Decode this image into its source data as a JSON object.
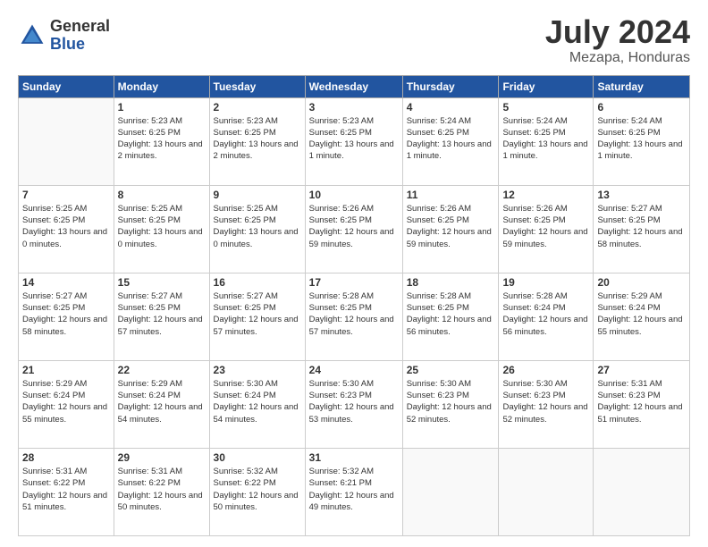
{
  "logo": {
    "general": "General",
    "blue": "Blue"
  },
  "title": "July 2024",
  "subtitle": "Mezapa, Honduras",
  "weekdays": [
    "Sunday",
    "Monday",
    "Tuesday",
    "Wednesday",
    "Thursday",
    "Friday",
    "Saturday"
  ],
  "weeks": [
    [
      null,
      {
        "day": 1,
        "sunrise": "5:23 AM",
        "sunset": "6:25 PM",
        "daylight": "13 hours and 2 minutes."
      },
      {
        "day": 2,
        "sunrise": "5:23 AM",
        "sunset": "6:25 PM",
        "daylight": "13 hours and 2 minutes."
      },
      {
        "day": 3,
        "sunrise": "5:23 AM",
        "sunset": "6:25 PM",
        "daylight": "13 hours and 1 minute."
      },
      {
        "day": 4,
        "sunrise": "5:24 AM",
        "sunset": "6:25 PM",
        "daylight": "13 hours and 1 minute."
      },
      {
        "day": 5,
        "sunrise": "5:24 AM",
        "sunset": "6:25 PM",
        "daylight": "13 hours and 1 minute."
      },
      {
        "day": 6,
        "sunrise": "5:24 AM",
        "sunset": "6:25 PM",
        "daylight": "13 hours and 1 minute."
      }
    ],
    [
      {
        "day": 7,
        "sunrise": "5:25 AM",
        "sunset": "6:25 PM",
        "daylight": "13 hours and 0 minutes."
      },
      {
        "day": 8,
        "sunrise": "5:25 AM",
        "sunset": "6:25 PM",
        "daylight": "13 hours and 0 minutes."
      },
      {
        "day": 9,
        "sunrise": "5:25 AM",
        "sunset": "6:25 PM",
        "daylight": "13 hours and 0 minutes."
      },
      {
        "day": 10,
        "sunrise": "5:26 AM",
        "sunset": "6:25 PM",
        "daylight": "12 hours and 59 minutes."
      },
      {
        "day": 11,
        "sunrise": "5:26 AM",
        "sunset": "6:25 PM",
        "daylight": "12 hours and 59 minutes."
      },
      {
        "day": 12,
        "sunrise": "5:26 AM",
        "sunset": "6:25 PM",
        "daylight": "12 hours and 59 minutes."
      },
      {
        "day": 13,
        "sunrise": "5:27 AM",
        "sunset": "6:25 PM",
        "daylight": "12 hours and 58 minutes."
      }
    ],
    [
      {
        "day": 14,
        "sunrise": "5:27 AM",
        "sunset": "6:25 PM",
        "daylight": "12 hours and 58 minutes."
      },
      {
        "day": 15,
        "sunrise": "5:27 AM",
        "sunset": "6:25 PM",
        "daylight": "12 hours and 57 minutes."
      },
      {
        "day": 16,
        "sunrise": "5:27 AM",
        "sunset": "6:25 PM",
        "daylight": "12 hours and 57 minutes."
      },
      {
        "day": 17,
        "sunrise": "5:28 AM",
        "sunset": "6:25 PM",
        "daylight": "12 hours and 57 minutes."
      },
      {
        "day": 18,
        "sunrise": "5:28 AM",
        "sunset": "6:25 PM",
        "daylight": "12 hours and 56 minutes."
      },
      {
        "day": 19,
        "sunrise": "5:28 AM",
        "sunset": "6:24 PM",
        "daylight": "12 hours and 56 minutes."
      },
      {
        "day": 20,
        "sunrise": "5:29 AM",
        "sunset": "6:24 PM",
        "daylight": "12 hours and 55 minutes."
      }
    ],
    [
      {
        "day": 21,
        "sunrise": "5:29 AM",
        "sunset": "6:24 PM",
        "daylight": "12 hours and 55 minutes."
      },
      {
        "day": 22,
        "sunrise": "5:29 AM",
        "sunset": "6:24 PM",
        "daylight": "12 hours and 54 minutes."
      },
      {
        "day": 23,
        "sunrise": "5:30 AM",
        "sunset": "6:24 PM",
        "daylight": "12 hours and 54 minutes."
      },
      {
        "day": 24,
        "sunrise": "5:30 AM",
        "sunset": "6:23 PM",
        "daylight": "12 hours and 53 minutes."
      },
      {
        "day": 25,
        "sunrise": "5:30 AM",
        "sunset": "6:23 PM",
        "daylight": "12 hours and 52 minutes."
      },
      {
        "day": 26,
        "sunrise": "5:30 AM",
        "sunset": "6:23 PM",
        "daylight": "12 hours and 52 minutes."
      },
      {
        "day": 27,
        "sunrise": "5:31 AM",
        "sunset": "6:23 PM",
        "daylight": "12 hours and 51 minutes."
      }
    ],
    [
      {
        "day": 28,
        "sunrise": "5:31 AM",
        "sunset": "6:22 PM",
        "daylight": "12 hours and 51 minutes."
      },
      {
        "day": 29,
        "sunrise": "5:31 AM",
        "sunset": "6:22 PM",
        "daylight": "12 hours and 50 minutes."
      },
      {
        "day": 30,
        "sunrise": "5:32 AM",
        "sunset": "6:22 PM",
        "daylight": "12 hours and 50 minutes."
      },
      {
        "day": 31,
        "sunrise": "5:32 AM",
        "sunset": "6:21 PM",
        "daylight": "12 hours and 49 minutes."
      },
      null,
      null,
      null
    ]
  ]
}
